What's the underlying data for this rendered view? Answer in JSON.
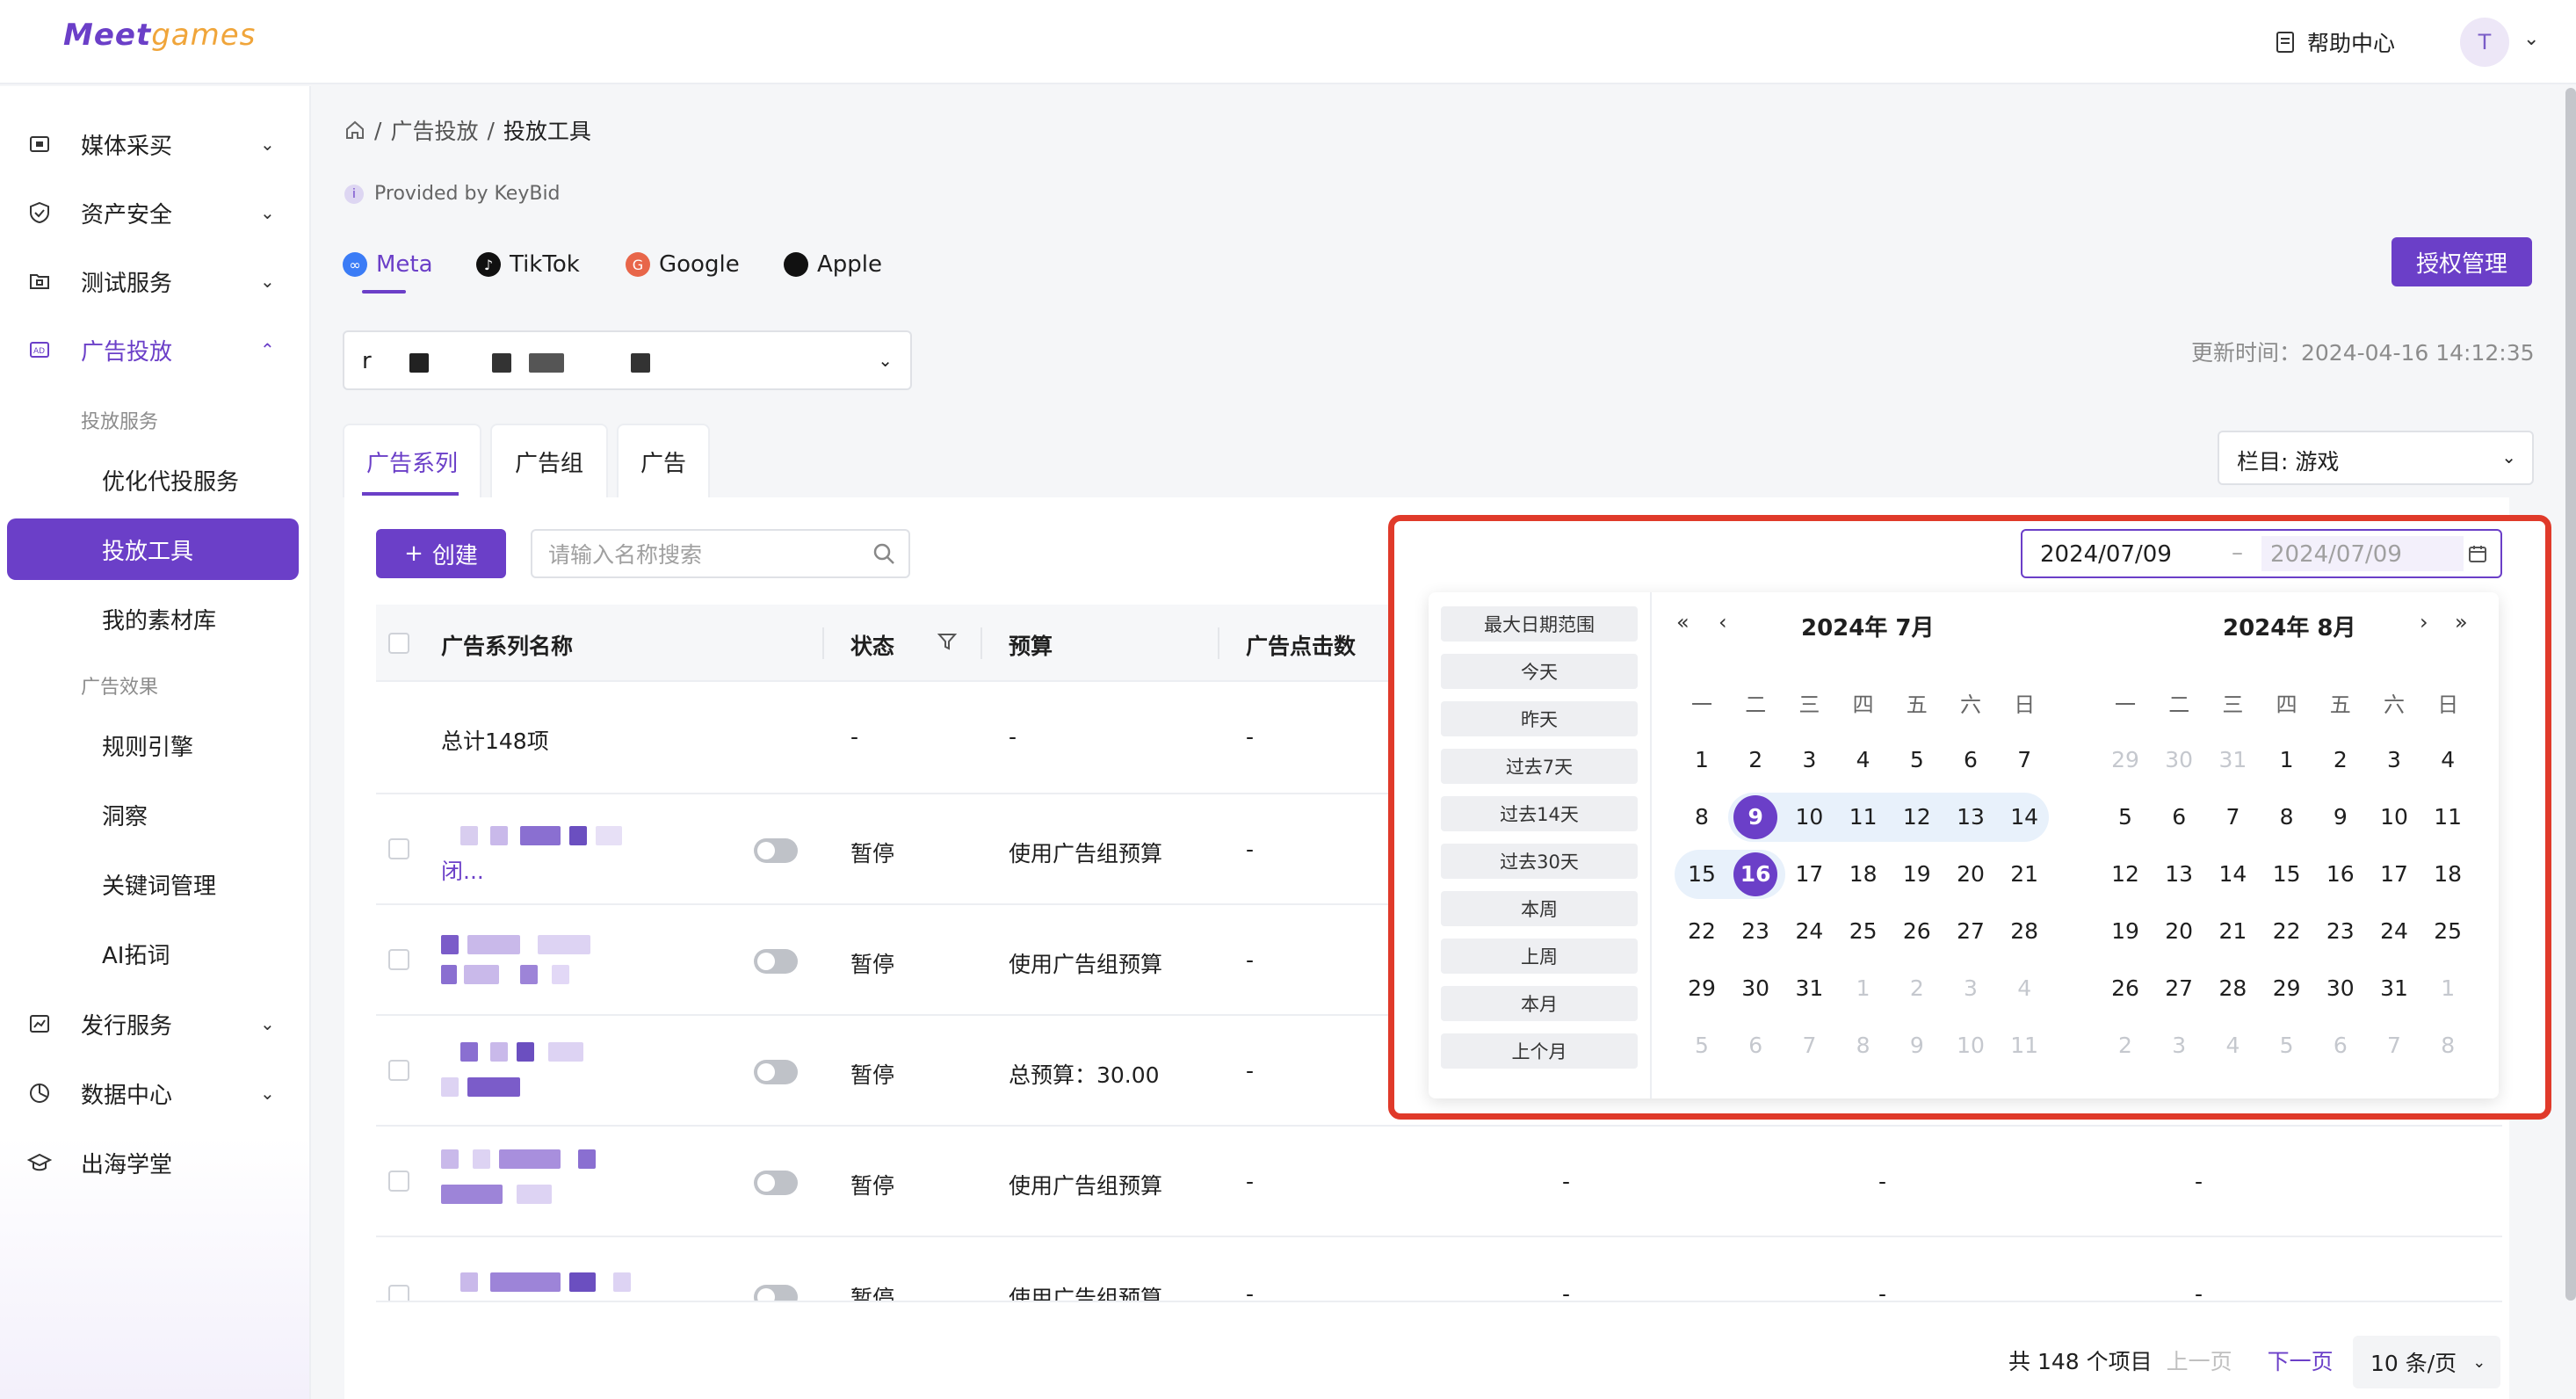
{
  "header": {
    "logo_main": "Meet",
    "logo_accent": "games",
    "help_label": "帮助中心",
    "avatar_text": "T"
  },
  "sidebar": {
    "items": [
      {
        "label": "媒体采买",
        "icon": "cart-icon"
      },
      {
        "label": "资产安全",
        "icon": "shield-icon"
      },
      {
        "label": "测试服务",
        "icon": "test-icon"
      },
      {
        "label": "广告投放",
        "icon": "ad-icon"
      }
    ],
    "group_1": "投放服务",
    "sub_1": [
      "优化代投服务",
      "投放工具",
      "我的素材库"
    ],
    "group_2": "广告效果",
    "sub_2": [
      "规则引擎",
      "洞察",
      "关键词管理",
      "AI拓词"
    ],
    "bottom_items": [
      {
        "label": "发行服务",
        "icon": "publish-icon"
      },
      {
        "label": "数据中心",
        "icon": "data-icon"
      },
      {
        "label": "出海学堂",
        "icon": "graduation-icon"
      }
    ]
  },
  "breadcrumb": {
    "home_icon": "home-icon",
    "level1": "广告投放",
    "current": "投放工具",
    "sep": "/"
  },
  "provided_by": "Provided by KeyBid",
  "platform_tabs": [
    "Meta",
    "TikTok",
    "Google",
    "Apple"
  ],
  "auth_button": "授权管理",
  "account_select": {
    "value_prefix": "r"
  },
  "update_time": "更新时间：2024-04-16 14:12:35",
  "level_tabs": [
    "广告系列",
    "广告组",
    "广告"
  ],
  "columns_select": "栏目: 游戏",
  "create_button": "创建",
  "search": {
    "placeholder": "请输入名称搜索"
  },
  "table": {
    "headers": [
      "广告系列名称",
      "状态",
      "预算",
      "广告点击数"
    ],
    "total_row": {
      "name": "总计148项",
      "status": "-",
      "budget": "-",
      "clicks": "-"
    },
    "rows": [
      {
        "name_suffix": "闭...",
        "status": "暂停",
        "budget": "使用广告组预算",
        "clicks": "-"
      },
      {
        "name_suffix": "",
        "status": "暂停",
        "budget": "使用广告组预算",
        "clicks": "-"
      },
      {
        "name_suffix": "",
        "status": "暂停",
        "budget": "总预算：30.00",
        "clicks": "-"
      },
      {
        "name_suffix": "",
        "status": "暂停",
        "budget": "使用广告组预算",
        "clicks": "-",
        "extra": [
          "-",
          "-",
          "-"
        ]
      },
      {
        "name_suffix": "",
        "status": "暂停",
        "budget": "使用广告组预算",
        "clicks": "-",
        "extra": [
          "-",
          "-",
          "-"
        ]
      }
    ]
  },
  "pagination": {
    "total": "共 148 个项目",
    "prev": "上一页",
    "next": "下一页",
    "page_size": "10 条/页"
  },
  "date_picker": {
    "start": "2024/07/09",
    "end": "2024/07/09",
    "presets": [
      "最大日期范围",
      "今天",
      "昨天",
      "过去7天",
      "过去14天",
      "过去30天",
      "本周",
      "上周",
      "本月",
      "上个月"
    ],
    "weekdays": [
      "一",
      "二",
      "三",
      "四",
      "五",
      "六",
      "日"
    ],
    "left_title": "2024年  7月",
    "right_title": "2024年  8月",
    "left_days": [
      "1",
      "2",
      "3",
      "4",
      "5",
      "6",
      "7",
      "8",
      "9",
      "10",
      "11",
      "12",
      "13",
      "14",
      "15",
      "16",
      "17",
      "18",
      "19",
      "20",
      "21",
      "22",
      "23",
      "24",
      "25",
      "26",
      "27",
      "28",
      "29",
      "30",
      "31",
      "1",
      "2",
      "3",
      "4",
      "5",
      "6",
      "7",
      "8",
      "9",
      "10",
      "11"
    ],
    "right_days": [
      "29",
      "30",
      "31",
      "1",
      "2",
      "3",
      "4",
      "5",
      "6",
      "7",
      "8",
      "9",
      "10",
      "11",
      "12",
      "13",
      "14",
      "15",
      "16",
      "17",
      "18",
      "19",
      "20",
      "21",
      "22",
      "23",
      "24",
      "25",
      "26",
      "27",
      "28",
      "29",
      "30",
      "31",
      "1",
      "2",
      "3",
      "4",
      "5",
      "6",
      "7",
      "8"
    ],
    "selected_start": "9",
    "hover_end": "16",
    "accent": "#6b3fc8",
    "highlight_border": "#e03a2a"
  }
}
